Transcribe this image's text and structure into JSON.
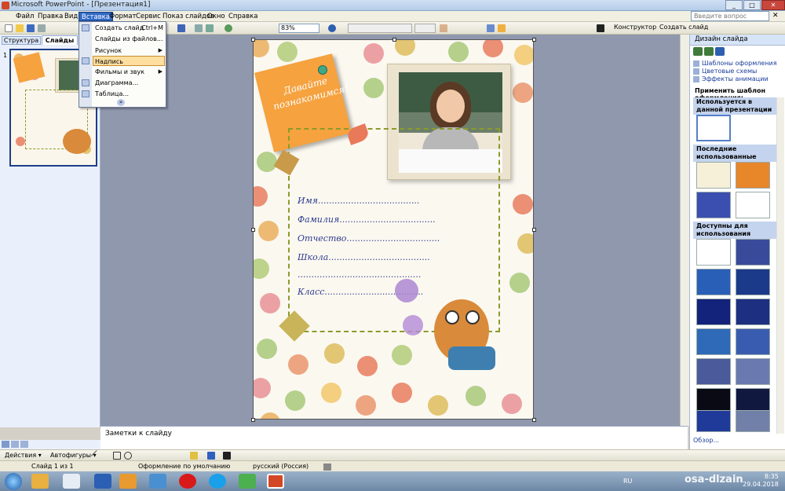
{
  "window": {
    "title": "Microsoft PowerPoint - [Презентация1]",
    "help_placeholder": "Введите вопрос"
  },
  "menu": [
    "Файл",
    "Правка",
    "Вид",
    "Вставка",
    "Формат",
    "Сервис",
    "Показ слайдов",
    "Окно",
    "Справка"
  ],
  "toolbar": {
    "zoom": "83%",
    "designer_label": "Конструктор",
    "new_slide_label": "Создать слайд"
  },
  "insert_menu": [
    {
      "label": "Создать слайд",
      "shortcut": "Ctrl+M",
      "submenu": false
    },
    {
      "label": "Слайды из файлов...",
      "shortcut": "",
      "submenu": false
    },
    {
      "label": "Рисунок",
      "shortcut": "",
      "submenu": true
    },
    {
      "label": "Надпись",
      "shortcut": "",
      "submenu": false
    },
    {
      "label": "Фильмы и звук",
      "shortcut": "",
      "submenu": true
    },
    {
      "label": "Диаграмма...",
      "shortcut": "",
      "submenu": false
    },
    {
      "label": "Таблица...",
      "shortcut": "",
      "submenu": false
    }
  ],
  "left_panel": {
    "tab_structure": "Структура",
    "tab_slides": "Слайды",
    "slide_number": "1"
  },
  "slide": {
    "note_text": "Давайте познакомимся!",
    "fields": [
      "Имя.....................................",
      "Фамилия...................................",
      "Отчество..................................",
      "Школа.....................................",
      ".............................................",
      "Класс...................................."
    ]
  },
  "notes": {
    "placeholder": "Заметки к слайду"
  },
  "task_pane": {
    "title": "Дизайн слайда",
    "links": [
      "Шаблоны оформления",
      "Цветовые схемы",
      "Эффекты анимации"
    ],
    "apply_label": "Применить шаблон оформления:",
    "sections": [
      "Используется в данной презентации",
      "Последние использованные",
      "Доступны для использования"
    ],
    "overview": "Обзор..."
  },
  "draw_toolbar": {
    "actions": "Действия ▾",
    "autoshapes": "Автофигуры ▾"
  },
  "status": {
    "slide": "Слайд 1 из 1",
    "design": "Оформление по умолчанию",
    "lang": "русский (Россия)"
  },
  "taskbar": {
    "lang": "RU",
    "time": "8:35",
    "date": "29.04.2018",
    "watermark": "osa-dlzain"
  }
}
